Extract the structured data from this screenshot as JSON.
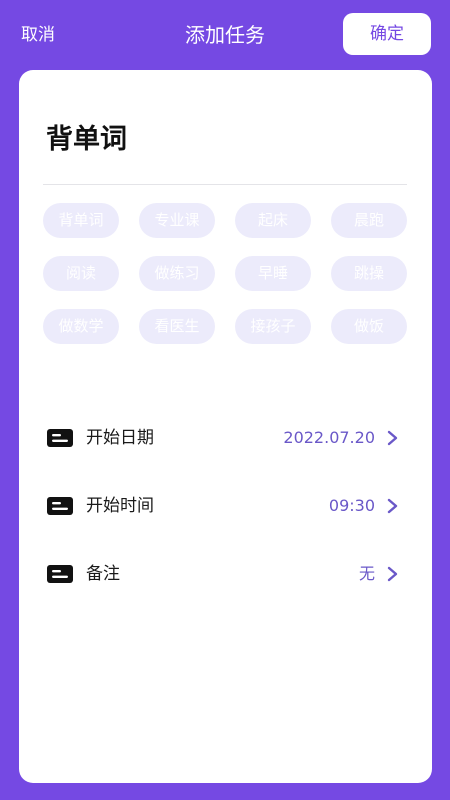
{
  "header": {
    "cancel_label": "取消",
    "title": "添加任务",
    "confirm_label": "确定"
  },
  "task": {
    "name": "背单词"
  },
  "tags": [
    "背单词",
    "专业课",
    "起床",
    "晨跑",
    "阅读",
    "做练习",
    "早睡",
    "跳操",
    "做数学",
    "看医生",
    "接孩子",
    "做饭"
  ],
  "settings": [
    {
      "label": "开始日期",
      "value": "2022.07.20",
      "icon": "calendar-icon"
    },
    {
      "label": "开始时间",
      "value": "09:30",
      "icon": "clock-icon"
    },
    {
      "label": "备注",
      "value": "无",
      "icon": "note-icon"
    }
  ],
  "colors": {
    "accent": "#7549e3",
    "chip_bg": "#ecebfb",
    "value_text": "#6a58c8"
  }
}
